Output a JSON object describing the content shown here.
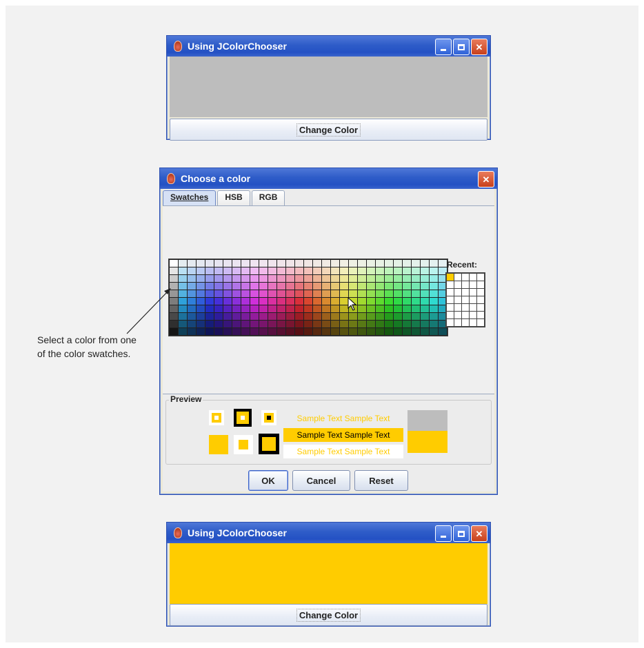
{
  "window_top": {
    "title": "Using JColorChooser",
    "button_label": "Change Color",
    "content_color": "#bdbdbd"
  },
  "dialog": {
    "title": "Choose a color",
    "tabs": [
      {
        "label": "Swatches",
        "active": true
      },
      {
        "label": "HSB",
        "active": false
      },
      {
        "label": "RGB",
        "active": false
      }
    ],
    "recent_label": "Recent:",
    "recent_first_color": "#ffcc00",
    "preview_label": "Preview",
    "sample_text": "Sample Text  Sample Text",
    "preview_old_color": "#bdbdbd",
    "preview_new_color": "#ffcc00",
    "buttons": {
      "ok": "OK",
      "cancel": "Cancel",
      "reset": "Reset"
    }
  },
  "window_bottom": {
    "title": "Using JColorChooser",
    "button_label": "Change Color",
    "content_color": "#ffcc00"
  },
  "annotation": {
    "text": "Select a color from one of the color swatches."
  },
  "colors": {
    "titlebar": "#2e5cc8",
    "selected": "#ffcc00"
  }
}
